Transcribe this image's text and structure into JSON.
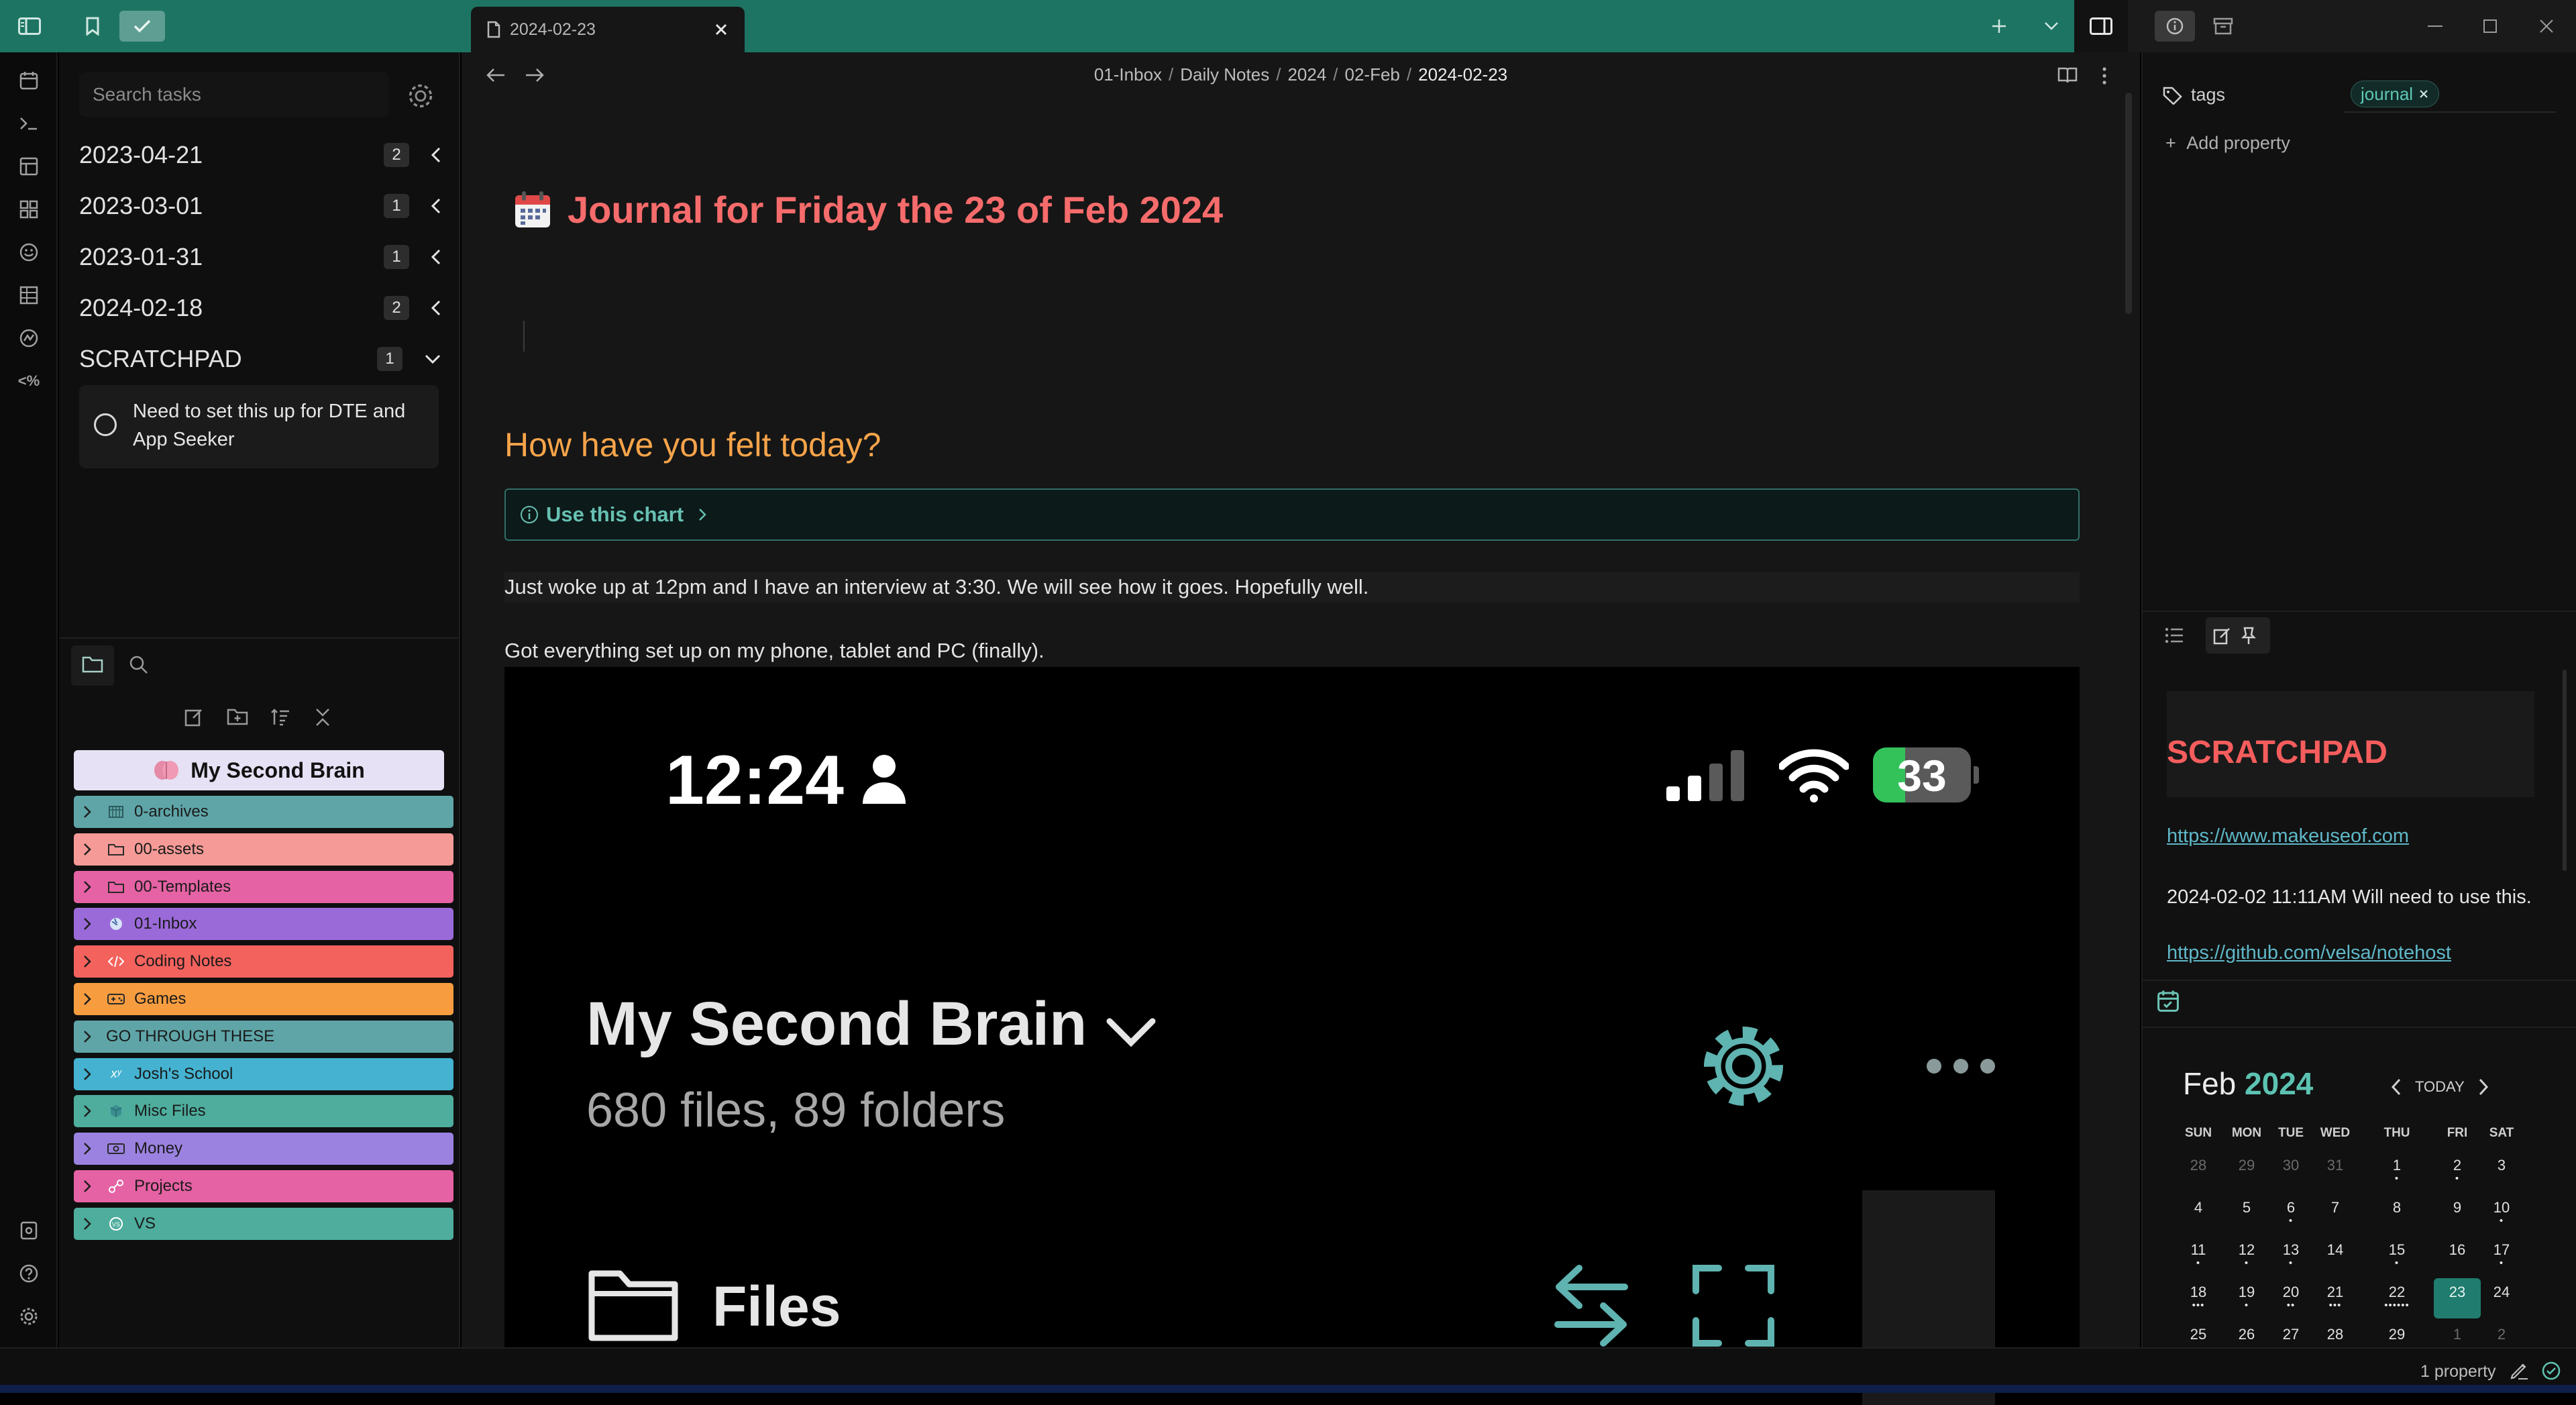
{
  "tab": {
    "title": "2024-02-23"
  },
  "tasks": {
    "search_placeholder": "Search tasks",
    "groups": [
      {
        "label": "2023-04-21",
        "count": "2"
      },
      {
        "label": "2023-03-01",
        "count": "1"
      },
      {
        "label": "2023-01-31",
        "count": "1"
      },
      {
        "label": "2024-02-18",
        "count": "2"
      },
      {
        "label": "SCRATCHPAD",
        "count": "1"
      }
    ],
    "open_task": "Need to set this up for DTE and App Seeker"
  },
  "file_tree": {
    "root": "My Second Brain",
    "folders": [
      {
        "label": "0-archives",
        "color": "#5fa5a8",
        "icon": "archive-icon"
      },
      {
        "label": "00-assets",
        "color": "#f59a96",
        "icon": "folder-icon"
      },
      {
        "label": "00-Templates",
        "color": "#e562a4",
        "icon": "folder-icon"
      },
      {
        "label": "01-Inbox",
        "color": "#9b6ad9",
        "icon": "globe-icon"
      },
      {
        "label": "Coding Notes",
        "color": "#f4625d",
        "icon": "code-icon"
      },
      {
        "label": "Games",
        "color": "#f79d40",
        "icon": "gamepad-icon"
      },
      {
        "label": "GO THROUGH THESE",
        "color": "#5fa5a8",
        "icon": ""
      },
      {
        "label": "Josh's School",
        "color": "#44b2d0",
        "icon": "math-icon"
      },
      {
        "label": "Misc Files",
        "color": "#4ead9d",
        "icon": "cube-icon"
      },
      {
        "label": "Money",
        "color": "#9b82e0",
        "icon": "money-icon"
      },
      {
        "label": "Projects",
        "color": "#e562a4",
        "icon": "link-icon"
      },
      {
        "label": "VS",
        "color": "#4ead9d",
        "icon": "vs-icon"
      }
    ]
  },
  "breadcrumb": {
    "parts": [
      "01-Inbox",
      "Daily Notes",
      "2024",
      "02-Feb"
    ],
    "current": "2024-02-23",
    "separator": "/"
  },
  "note": {
    "title": "Journal for Friday the 23 of Feb 2024",
    "heading": "How have you felt today?",
    "callout": "Use this chart",
    "line1": "Just woke up at 12pm and I have an interview at 3:30. We will see how it goes. Hopefully well.",
    "line2": "Got everything set up on my phone, tablet and PC (finally)."
  },
  "embedded_image": {
    "time": "12:24",
    "battery": "33",
    "battery_level": 0.33,
    "vault_name": "My Second Brain",
    "vault_stats": "680 files, 89 folders",
    "files_label": "Files"
  },
  "properties": {
    "tags_label": "tags",
    "tag_value": "journal",
    "add_property": "Add property"
  },
  "scratchpad": {
    "title": "SCRATCHPAD",
    "link1": "https://www.makeuseof.com",
    "date_line": "2024-02-02 11:11AM  Will need to use this.",
    "link2": "https://github.com/velsa/notehost"
  },
  "calendar": {
    "month": "Feb",
    "year": "2024",
    "today_label": "TODAY",
    "weekdays": [
      "SUN",
      "MON",
      "TUE",
      "WED",
      "THU",
      "FRI",
      "SAT"
    ],
    "weeks": [
      [
        {
          "d": "28",
          "other": true
        },
        {
          "d": "29",
          "other": true
        },
        {
          "d": "30",
          "other": true
        },
        {
          "d": "31",
          "other": true
        },
        {
          "d": "1",
          "dots": "•"
        },
        {
          "d": "2",
          "dots": "•"
        },
        {
          "d": "3"
        }
      ],
      [
        {
          "d": "4"
        },
        {
          "d": "5"
        },
        {
          "d": "6",
          "dots": "•"
        },
        {
          "d": "7"
        },
        {
          "d": "8"
        },
        {
          "d": "9"
        },
        {
          "d": "10",
          "dots": "•"
        }
      ],
      [
        {
          "d": "11",
          "dots": "•"
        },
        {
          "d": "12",
          "dots": "•"
        },
        {
          "d": "13",
          "dots": "•"
        },
        {
          "d": "14"
        },
        {
          "d": "15",
          "dots": "•"
        },
        {
          "d": "16"
        },
        {
          "d": "17",
          "dots": "•"
        }
      ],
      [
        {
          "d": "18",
          "dots": "•••"
        },
        {
          "d": "19",
          "dots": "•"
        },
        {
          "d": "20",
          "dots": "••"
        },
        {
          "d": "21",
          "dots": "•••"
        },
        {
          "d": "22",
          "dots": "••••••"
        },
        {
          "d": "23",
          "today": true
        },
        {
          "d": "24"
        }
      ],
      [
        {
          "d": "25"
        },
        {
          "d": "26"
        },
        {
          "d": "27"
        },
        {
          "d": "28"
        },
        {
          "d": "29"
        },
        {
          "d": "1",
          "other": true
        },
        {
          "d": "2",
          "other": true
        }
      ]
    ]
  },
  "status": {
    "properties": "1 property"
  }
}
